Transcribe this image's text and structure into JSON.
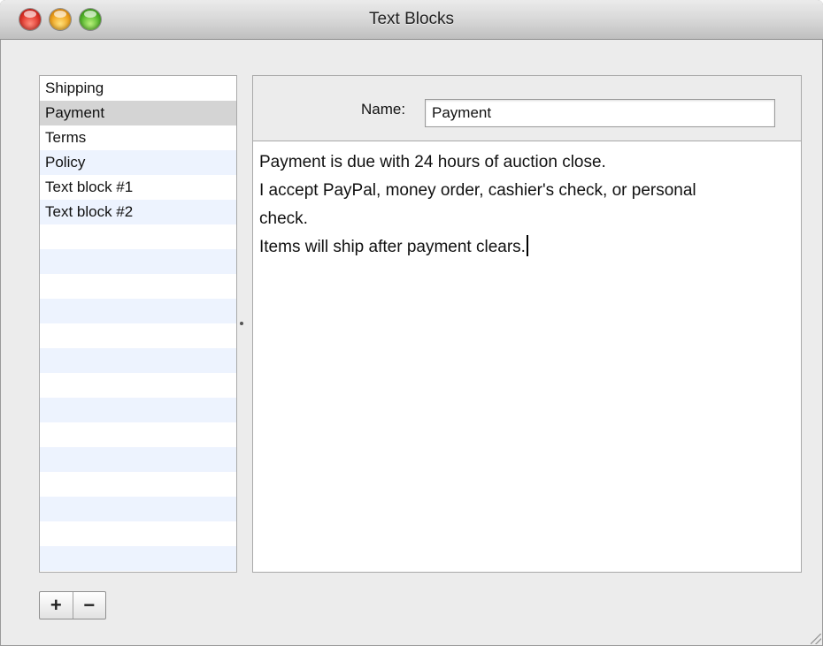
{
  "window": {
    "title": "Text Blocks"
  },
  "list": {
    "items": [
      {
        "label": "Shipping"
      },
      {
        "label": "Payment"
      },
      {
        "label": "Terms"
      },
      {
        "label": "Policy"
      },
      {
        "label": "Text block #1"
      },
      {
        "label": "Text block #2"
      }
    ],
    "selected_index": 1
  },
  "editor": {
    "name_label": "Name:",
    "name_value": "Payment",
    "body_lines": [
      "Payment is due with 24 hours of auction close.",
      "I accept PayPal, money order, cashier's check, or personal",
      "check.",
      "Items will ship after payment clears."
    ]
  },
  "toolbar": {
    "add_label": "+",
    "remove_label": "−"
  },
  "colors": {
    "selection": "#d4d4d4",
    "stripe": "#edf3fe"
  },
  "icons": {
    "close": "close-icon",
    "minimize": "minimize-icon",
    "zoom": "zoom-icon"
  }
}
